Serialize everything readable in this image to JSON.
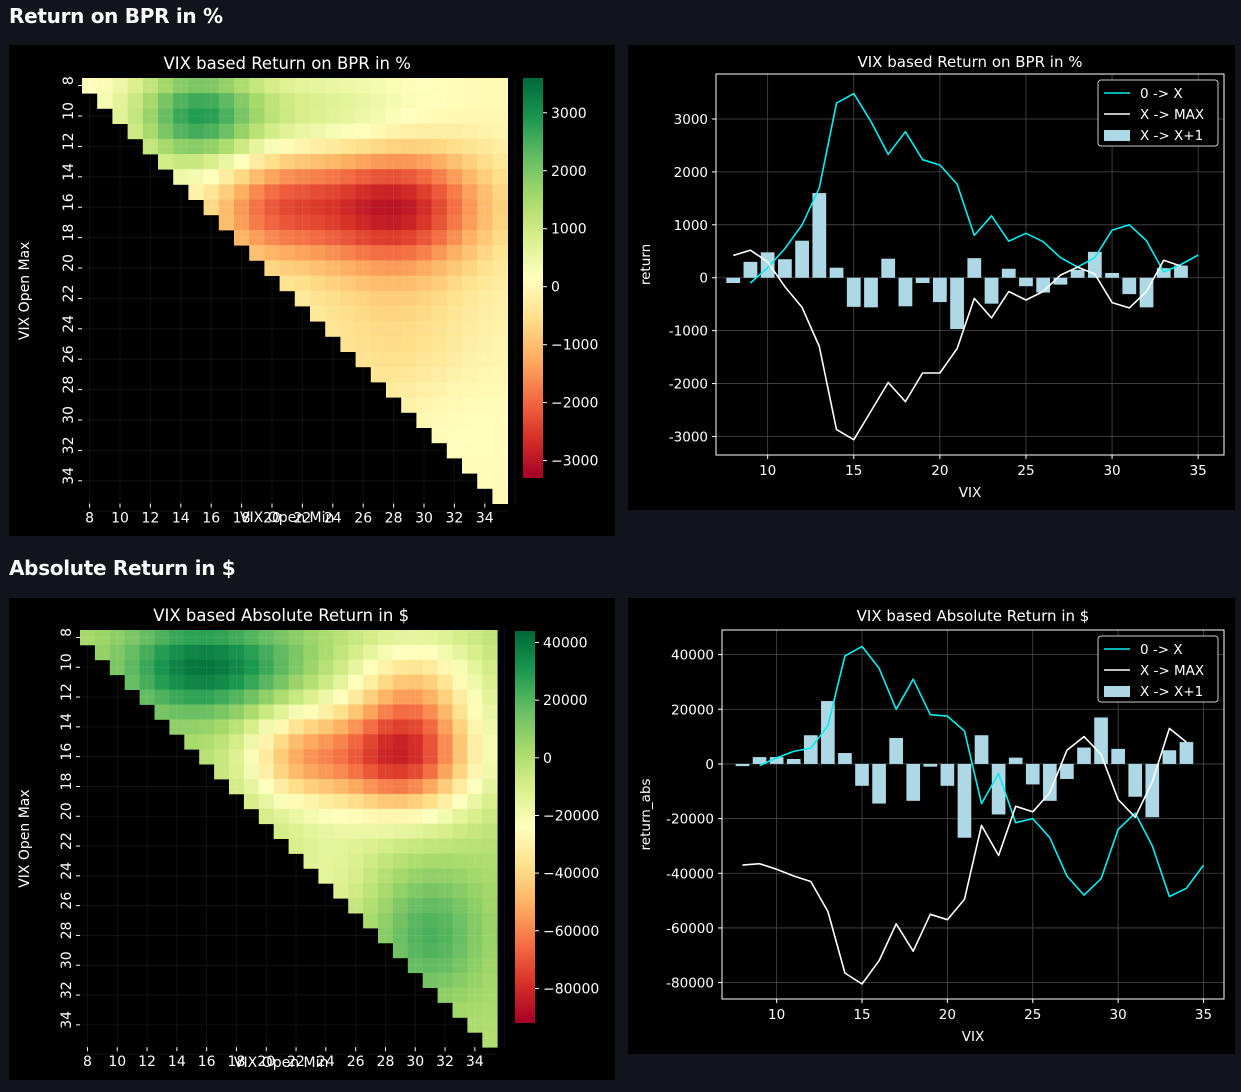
{
  "sections": [
    {
      "header": "Return on BPR in %"
    },
    {
      "header": "Absolute Return in $"
    }
  ],
  "colors": {
    "cyan_line": "#00f0f0",
    "white_line": "#ffffff",
    "bar": "#add8e6",
    "grid": "#555555",
    "heatmap_low": "#a50026",
    "heatmap_mid": "#ffffbf",
    "heatmap_high": "#00924a"
  },
  "chart_data": [
    {
      "type": "heatmap",
      "title": "VIX based Return on BPR in %",
      "xlabel": "VIX Open Min",
      "ylabel": "VIX Open Max",
      "x_ticks": [
        "8",
        "10",
        "12",
        "14",
        "16",
        "18",
        "20",
        "22",
        "24",
        "26",
        "28",
        "30",
        "32",
        "34"
      ],
      "y_ticks": [
        "8",
        "10",
        "12",
        "14",
        "16",
        "18",
        "20",
        "22",
        "24",
        "26",
        "28",
        "30",
        "32",
        "34"
      ],
      "x_range": [
        8,
        35
      ],
      "y_range": [
        8,
        35
      ],
      "colorbar": {
        "min": -3300,
        "max": 3600,
        "ticks": [
          3000,
          2000,
          1000,
          0,
          -1000,
          -2000,
          -3000
        ],
        "tick_labels": [
          "3000",
          "2000",
          "1000",
          "0",
          "−1000",
          "−2000",
          "−3000"
        ]
      },
      "pattern": "upper-triangle; rows 8-13 green-yellow (peak ~3000 around min 14-16), rows 14-21 red (trough ~-3000 around min 27-33), rows 22-35 yellow/orange"
    },
    {
      "type": "line",
      "title": "VIX based Return on BPR in %",
      "xlabel": "VIX",
      "ylabel": "return",
      "xlim": [
        7,
        36.5
      ],
      "ylim": [
        -3350,
        3850
      ],
      "x_ticks": [
        10,
        15,
        20,
        25,
        30,
        35
      ],
      "y_ticks": [
        3000,
        2000,
        1000,
        0,
        -1000,
        -2000,
        -3000
      ],
      "legend": "top-right",
      "legend_labels": [
        "0 -> X",
        "X -> MAX",
        "X -> X+1"
      ],
      "x": [
        8,
        9,
        10,
        11,
        12,
        13,
        14,
        15,
        16,
        17,
        18,
        19,
        20,
        21,
        22,
        23,
        24,
        25,
        26,
        27,
        28,
        29,
        30,
        31,
        32,
        33,
        34,
        35
      ],
      "series": [
        {
          "name": "0 -> X",
          "kind": "line",
          "color": "#00f0f0",
          "values": [
            null,
            -100,
            190,
            550,
            1000,
            1700,
            3300,
            3480,
            2950,
            2330,
            2760,
            2230,
            2130,
            1770,
            800,
            1170,
            690,
            840,
            680,
            380,
            200,
            380,
            900,
            1000,
            700,
            110,
            250,
            430
          ]
        },
        {
          "name": "X -> MAX",
          "kind": "line",
          "color": "#ffffff",
          "values": [
            420,
            520,
            300,
            -170,
            -560,
            -1300,
            -2870,
            -3060,
            -2520,
            -1980,
            -2340,
            -1800,
            -1800,
            -1340,
            -390,
            -760,
            -260,
            -420,
            -260,
            50,
            200,
            70,
            -470,
            -570,
            -260,
            330,
            220,
            null
          ]
        },
        {
          "name": "X -> X+1",
          "kind": "bar",
          "color": "#add8e6",
          "values": [
            -100,
            300,
            480,
            350,
            700,
            1600,
            190,
            -550,
            -560,
            360,
            -540,
            -100,
            -460,
            -970,
            370,
            -490,
            170,
            -160,
            -280,
            -130,
            150,
            490,
            90,
            -310,
            -560,
            180,
            230,
            null
          ]
        }
      ]
    },
    {
      "type": "heatmap",
      "title": "VIX based Absolute Return in $",
      "xlabel": "VIX Open Min",
      "ylabel": "VIX Open Max",
      "x_ticks": [
        "8",
        "10",
        "12",
        "14",
        "16",
        "18",
        "20",
        "22",
        "24",
        "26",
        "28",
        "30",
        "32",
        "34"
      ],
      "y_ticks": [
        "8",
        "10",
        "12",
        "14",
        "16",
        "18",
        "20",
        "22",
        "24",
        "26",
        "28",
        "30",
        "32",
        "34"
      ],
      "x_range": [
        8,
        35
      ],
      "y_range": [
        8,
        35
      ],
      "colorbar": {
        "min": -92000,
        "max": 44000,
        "ticks": [
          40000,
          20000,
          0,
          -20000,
          -40000,
          -60000,
          -80000
        ],
        "tick_labels": [
          "40000",
          "20000",
          "0",
          "−20000",
          "−40000",
          "−60000",
          "−80000"
        ]
      },
      "pattern": "upper-triangle; rows 8-13 green (peak around min 14-18), rows 14-21 orange/red (trough around min 28-34), rows 22-35 yellow/green"
    },
    {
      "type": "line",
      "title": "VIX based Absolute Return in $",
      "xlabel": "VIX",
      "ylabel": "return_abs",
      "xlim": [
        6.8,
        36.2
      ],
      "ylim": [
        -86000,
        49000
      ],
      "x_ticks": [
        10,
        15,
        20,
        25,
        30,
        35
      ],
      "y_ticks": [
        40000,
        20000,
        0,
        -20000,
        -40000,
        -60000,
        -80000
      ],
      "legend": "top-right",
      "legend_labels": [
        "0 -> X",
        "X -> MAX",
        "X -> X+1"
      ],
      "x": [
        8,
        9,
        10,
        11,
        12,
        13,
        14,
        15,
        16,
        17,
        18,
        19,
        20,
        21,
        22,
        23,
        24,
        25,
        26,
        27,
        28,
        29,
        30,
        31,
        32,
        33,
        34,
        35
      ],
      "series": [
        {
          "name": "0 -> X",
          "kind": "line",
          "color": "#00f0f0",
          "values": [
            null,
            -600,
            2200,
            4600,
            5800,
            14000,
            39500,
            43000,
            35000,
            20000,
            31000,
            18000,
            17500,
            12000,
            -14500,
            -3500,
            -21500,
            -20000,
            -27000,
            -41000,
            -48000,
            -42000,
            -24000,
            -18000,
            -30000,
            -48500,
            -45500,
            -37000
          ]
        },
        {
          "name": "X -> MAX",
          "kind": "line",
          "color": "#ffffff",
          "values": [
            -37000,
            -36500,
            -38500,
            -41000,
            -43000,
            -54000,
            -76500,
            -80500,
            -72000,
            -58500,
            -68500,
            -55000,
            -57000,
            -49500,
            -22500,
            -33500,
            -15500,
            -17500,
            -10500,
            5000,
            10000,
            3500,
            -13000,
            -19500,
            -6500,
            13000,
            8000,
            null
          ]
        },
        {
          "name": "X -> X+1",
          "kind": "bar",
          "color": "#add8e6",
          "values": [
            -800,
            2500,
            2500,
            1800,
            10500,
            23000,
            4000,
            -8000,
            -14500,
            9500,
            -13500,
            -1000,
            -8000,
            -27000,
            10500,
            -18500,
            2300,
            -7500,
            -13500,
            -5500,
            6000,
            17000,
            5500,
            -12000,
            -19500,
            5000,
            8000,
            null
          ]
        }
      ]
    }
  ]
}
